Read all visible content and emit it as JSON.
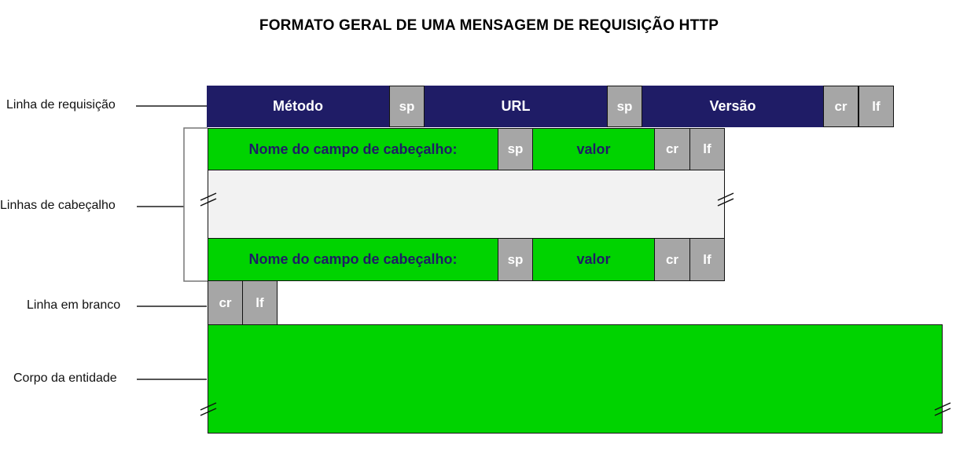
{
  "title": "FORMATO GERAL DE UMA MENSAGEM DE REQUISIÇÃO HTTP",
  "labels": {
    "request_line": "Linha de requisição",
    "header_lines": "Linhas de cabeçalho",
    "blank_line": "Linha em branco",
    "entity_body": "Corpo da entidade"
  },
  "request_line": {
    "method": "Método",
    "sp1": "sp",
    "url": "URL",
    "sp2": "sp",
    "version": "Versão",
    "cr": "cr",
    "lf": "lf"
  },
  "header_line": {
    "field_name": "Nome do campo de cabeçalho:",
    "sp": "sp",
    "value": "valor",
    "cr": "cr",
    "lf": "lf"
  },
  "blank_line": {
    "cr": "cr",
    "lf": "lf"
  },
  "colors": {
    "navy": "#1f1c66",
    "green": "#00d300",
    "gray": "#a6a6a6",
    "light": "#f2f2f2"
  }
}
